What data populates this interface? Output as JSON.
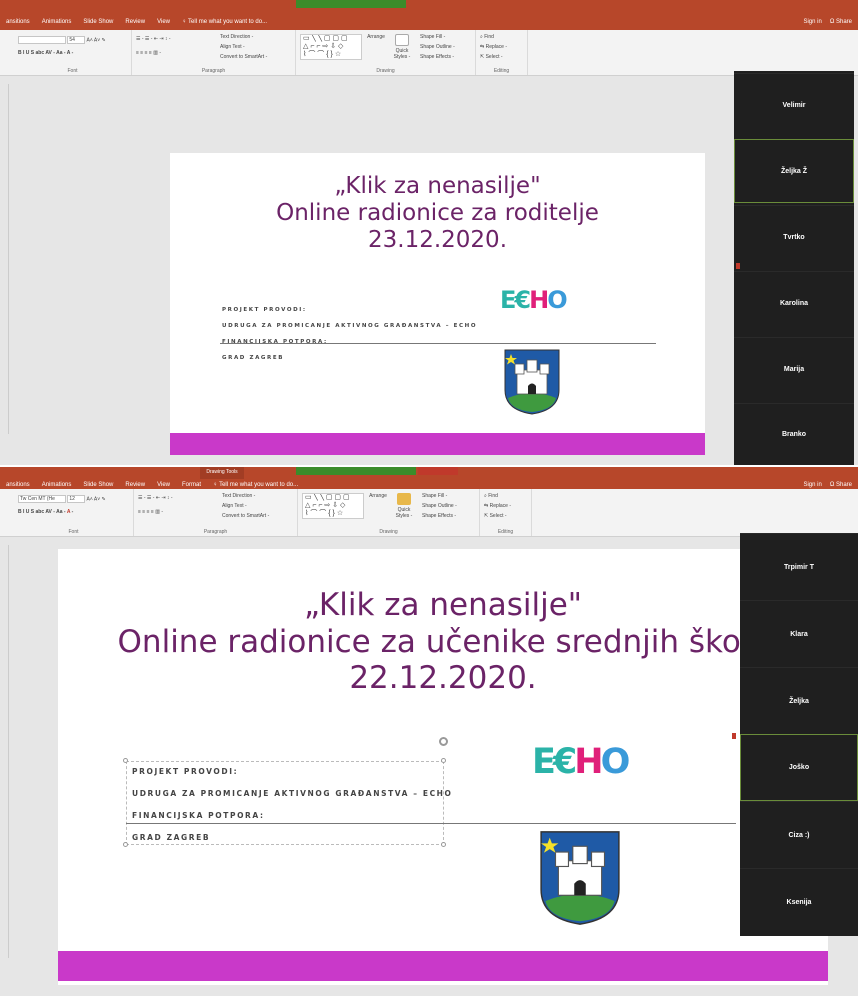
{
  "screens": [
    {
      "tabs": [
        "ansitions",
        "Animations",
        "Slide Show",
        "Review",
        "View"
      ],
      "tell_me": "♀ Tell me what you want to do...",
      "right_links": [
        "Sign in",
        "Ω Share"
      ],
      "ribbon": {
        "font_label": "Font",
        "font_size": "54",
        "paragraph_label": "Paragraph",
        "text_direction": "Text Direction -",
        "align_text": "Align Text -",
        "convert_smartart": "Convert to SmartArt -",
        "drawing_label": "Drawing",
        "arrange": "Arrange",
        "quick_styles": "Quick Styles -",
        "shape_fill": "Shape Fill -",
        "shape_outline": "Shape Outline -",
        "shape_effects": "Shape Effects -",
        "editing_label": "Editing",
        "find": "Find",
        "replace": "Replace -",
        "select": "Select -"
      },
      "slide": {
        "title_lines": [
          "„Klik za nenasilje\"",
          "Online radionice za roditelje",
          "23.12.2020."
        ],
        "info_lines": [
          "PROJEKT PROVODI:",
          "UDRUGA ZA PROMICANJE AKTIVNOG GRAĐANSTVA – ECHO",
          "FINANCIJSKA POTPORA:",
          "GRAD ZAGREB"
        ],
        "logo_parts": [
          "E",
          "H",
          "O"
        ]
      },
      "participants": [
        "Velimir",
        "Željka Ž",
        "Tvrtko",
        "Karolina",
        "Marija",
        "Branko"
      ],
      "active_participant": 1
    },
    {
      "tabs": [
        "ansitions",
        "Animations",
        "Slide Show",
        "Review",
        "View",
        "Format"
      ],
      "drawing_tools": "Drawing Tools",
      "tell_me": "♀ Tell me what you want to do...",
      "right_links": [
        "Sign in",
        "Ω Share"
      ],
      "ribbon": {
        "font_label": "Font",
        "font_name": "Tw Cen MT (He",
        "font_size": "12",
        "paragraph_label": "Paragraph",
        "text_direction": "Text Direction -",
        "align_text": "Align Text -",
        "convert_smartart": "Convert to SmartArt -",
        "drawing_label": "Drawing",
        "arrange": "Arrange",
        "quick_styles": "Quick Styles -",
        "shape_fill": "Shape Fill -",
        "shape_outline": "Shape Outline -",
        "shape_effects": "Shape Effects -",
        "editing_label": "Editing",
        "find": "Find",
        "replace": "Replace -",
        "select": "Select -"
      },
      "slide": {
        "title_lines": [
          "„Klik za nenasilje\"",
          "Online radionice za učenike srednjih škola",
          "22.12.2020."
        ],
        "info_lines": [
          "PROJEKT PROVODI:",
          "UDRUGA ZA PROMICANJE AKTIVNOG GRAĐANSTVA – ECHO",
          "FINANCIJSKA POTPORA:",
          "GRAD ZAGREB"
        ],
        "logo_parts": [
          "E",
          "H",
          "O"
        ]
      },
      "participants": [
        "Trpimir T",
        "Klara",
        "Željka",
        "Joško",
        "Ciza :)",
        "Ksenija"
      ],
      "active_participant": 3
    }
  ],
  "colors": {
    "ribbon_accent": "#b7472a",
    "title_purple": "#6b2367",
    "footer_magenta": "#c939c9",
    "gallery_bg": "#1f1f1f"
  }
}
